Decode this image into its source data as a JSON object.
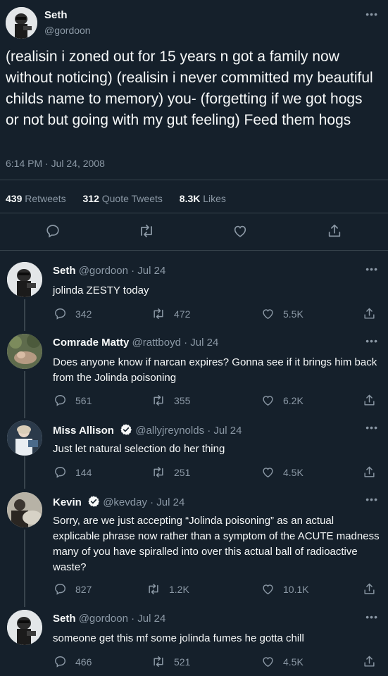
{
  "main_tweet": {
    "name": "Seth",
    "handle": "@gordoon",
    "more": "•••",
    "text": "(realisin i zoned out for 15 years n got a family now without noticing) (realisin i never committed my beautiful childs name to memory) you- (forgetting if we got hogs or not but going with my gut feeling) Feed them hogs",
    "timestamp": "6:14 PM · Jul 24, 2008",
    "stats": {
      "retweets_count": "439",
      "retweets_label": "Retweets",
      "quotes_count": "312",
      "quotes_label": "Quote Tweets",
      "likes_count": "8.3K",
      "likes_label": "Likes"
    }
  },
  "replies": [
    {
      "name": "Seth",
      "handle": "@gordoon",
      "date": "· Jul 24",
      "verified": false,
      "text": "jolinda ZESTY today",
      "replies": "342",
      "retweets": "472",
      "likes": "5.5K"
    },
    {
      "name": "Comrade Matty",
      "handle": "@rattboyd",
      "date": "· Jul 24",
      "verified": false,
      "text": "Does anyone know if narcan expires? Gonna see if it brings him back from the Jolinda poisoning",
      "replies": "561",
      "retweets": "355",
      "likes": "6.2K"
    },
    {
      "name": "Miss Allison",
      "handle": "@allyjreynolds",
      "date": "· Jul 24",
      "verified": true,
      "text": "Just let natural selection do her thing",
      "replies": "144",
      "retweets": "251",
      "likes": "4.5K"
    },
    {
      "name": "Kevin",
      "handle": "@kevday",
      "date": "· Jul 24",
      "verified": true,
      "text": "Sorry, are we just accepting “Jolinda poisoning” as an actual explicable phrase now rather than a symptom of the ACUTE madness many of you have spiralled into over this actual ball of radioactive waste?",
      "replies": "827",
      "retweets": "1.2K",
      "likes": "10.1K"
    },
    {
      "name": "Seth",
      "handle": "@gordoon",
      "date": "· Jul 24",
      "verified": false,
      "text": "someone get this mf some jolinda fumes he gotta chill",
      "replies": "466",
      "retweets": "521",
      "likes": "4.5K"
    }
  ],
  "icons": {
    "reply": "speech-bubble-icon",
    "retweet": "retweet-arrows-icon",
    "like": "heart-outline-icon",
    "share": "share-upload-icon",
    "verified": "verified-badge-icon"
  },
  "colors": {
    "background": "#15202b",
    "text": "#f7f9f9",
    "muted": "#8b98a5",
    "divider": "#38444d",
    "verified": "#f7f9f9"
  }
}
